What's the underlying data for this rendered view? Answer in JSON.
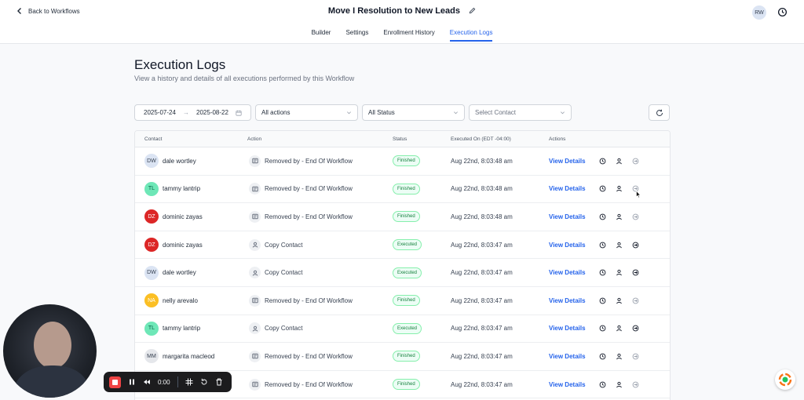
{
  "header": {
    "back_label": "Back to Workflows",
    "workflow_title": "Move I Resolution to New Leads",
    "user_initials": "RW"
  },
  "tabs": [
    {
      "label": "Builder",
      "active": false
    },
    {
      "label": "Settings",
      "active": false
    },
    {
      "label": "Enrollment History",
      "active": false
    },
    {
      "label": "Execution Logs",
      "active": true
    }
  ],
  "page": {
    "title": "Execution Logs",
    "subtitle": "View a history and details of all executions performed by this Workflow"
  },
  "filters": {
    "date_from": "2025-07-24",
    "date_to": "2025-08-22",
    "actions": "All actions",
    "status": "All Status",
    "contact_placeholder": "Select Contact"
  },
  "table": {
    "columns": {
      "contact": "Contact",
      "action": "Action",
      "status": "Status",
      "executed_on": "Executed On (EDT -04:00)",
      "actions": "Actions"
    },
    "view_label": "View Details",
    "rows": [
      {
        "initials": "DW",
        "name": "dale wortley",
        "avatar_bg": "#dbe4f3",
        "avatar_fg": "#374151",
        "action": "Removed by - End Of Workflow",
        "action_icon": "workflow-icon",
        "status": "Finished",
        "executed": "Aug 22nd, 8:03:48 am"
      },
      {
        "initials": "TL",
        "name": "tammy lantrip",
        "avatar_bg": "#6ee7b7",
        "avatar_fg": "#065f46",
        "action": "Removed by - End Of Workflow",
        "action_icon": "workflow-icon",
        "status": "Finished",
        "executed": "Aug 22nd, 8:03:48 am"
      },
      {
        "initials": "DZ",
        "name": "dominic zayas",
        "avatar_bg": "#dc2626",
        "avatar_fg": "#ffffff",
        "action": "Removed by - End Of Workflow",
        "action_icon": "workflow-icon",
        "status": "Finished",
        "executed": "Aug 22nd, 8:03:48 am"
      },
      {
        "initials": "DZ",
        "name": "dominic zayas",
        "avatar_bg": "#dc2626",
        "avatar_fg": "#ffffff",
        "action": "Copy Contact",
        "action_icon": "user-icon",
        "status": "Executed",
        "executed": "Aug 22nd, 8:03:47 am"
      },
      {
        "initials": "DW",
        "name": "dale wortley",
        "avatar_bg": "#dbe4f3",
        "avatar_fg": "#374151",
        "action": "Copy Contact",
        "action_icon": "user-icon",
        "status": "Executed",
        "executed": "Aug 22nd, 8:03:47 am"
      },
      {
        "initials": "NA",
        "name": "nelly arevalo",
        "avatar_bg": "#fbbf24",
        "avatar_fg": "#ffffff",
        "action": "Removed by - End Of Workflow",
        "action_icon": "workflow-icon",
        "status": "Finished",
        "executed": "Aug 22nd, 8:03:47 am"
      },
      {
        "initials": "TL",
        "name": "tammy lantrip",
        "avatar_bg": "#6ee7b7",
        "avatar_fg": "#065f46",
        "action": "Copy Contact",
        "action_icon": "user-icon",
        "status": "Executed",
        "executed": "Aug 22nd, 8:03:47 am"
      },
      {
        "initials": "MM",
        "name": "margarita macleod",
        "avatar_bg": "#e5e7eb",
        "avatar_fg": "#374151",
        "action": "Removed by - End Of Workflow",
        "action_icon": "workflow-icon",
        "status": "Finished",
        "executed": "Aug 22nd, 8:03:47 am"
      },
      {
        "initials": "",
        "name": "",
        "avatar_bg": "#ffffff",
        "avatar_fg": "#374151",
        "action": "Removed by - End Of Workflow",
        "action_icon": "workflow-icon",
        "status": "Finished",
        "executed": "Aug 22nd, 8:03:47 am"
      }
    ]
  },
  "recorder": {
    "timer": "0:00"
  }
}
